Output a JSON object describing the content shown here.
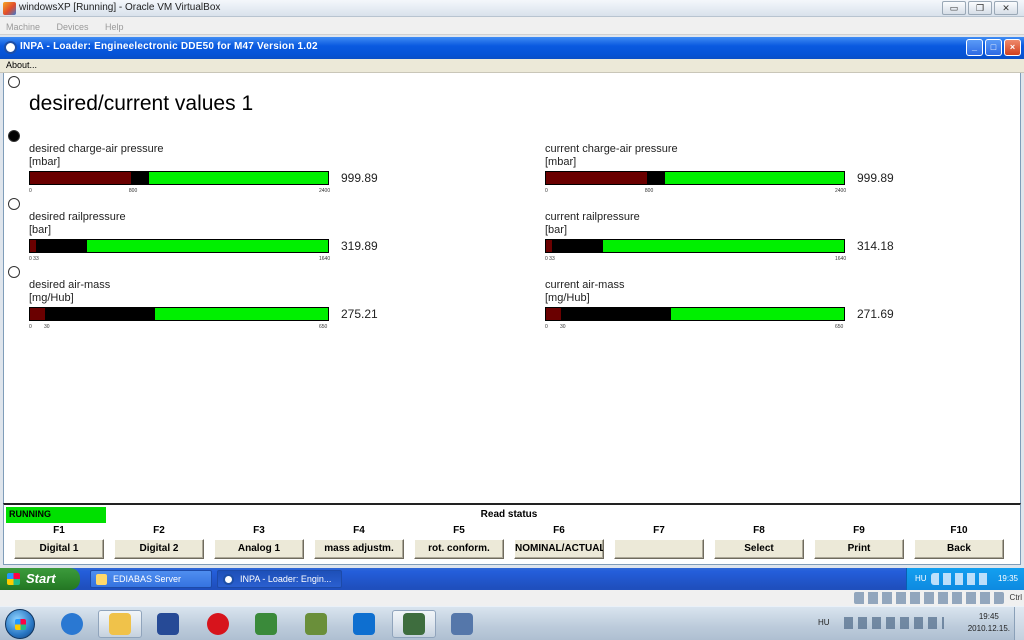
{
  "host_window": {
    "title": "windowsXP [Running] - Oracle VM VirtualBox",
    "menu": [
      "Machine",
      "Devices",
      "Help"
    ],
    "controls": [
      "▭",
      "❐",
      "✕"
    ]
  },
  "app_window": {
    "title": "INPA - Loader:  Engineelectronic DDE50 for M47 Version 1.02",
    "menu": [
      "About..."
    ]
  },
  "page": {
    "title": "desired/current values 1"
  },
  "gauges": [
    {
      "label": "desired charge-air pressure",
      "unit": "[mbar]",
      "value": "999.89",
      "fill": 0.4,
      "red": 0.34,
      "ticks": [
        {
          "t": "0",
          "p": 0
        },
        {
          "t": "800",
          "p": 0.333
        },
        {
          "t": "2400",
          "p": 1
        }
      ]
    },
    {
      "label": "current charge-air pressure",
      "unit": "[mbar]",
      "value": "999.89",
      "fill": 0.4,
      "red": 0.34,
      "ticks": [
        {
          "t": "0",
          "p": 0
        },
        {
          "t": "800",
          "p": 0.333
        },
        {
          "t": "2400",
          "p": 1
        }
      ]
    },
    {
      "label": "desired railpressure",
      "unit": "[bar]",
      "value": "319.89",
      "fill": 0.19,
      "red": 0.02,
      "ticks": [
        {
          "t": "0 33",
          "p": 0
        },
        {
          "t": "1640",
          "p": 1
        }
      ]
    },
    {
      "label": "current railpressure",
      "unit": "[bar]",
      "value": "314.18",
      "fill": 0.19,
      "red": 0.02,
      "ticks": [
        {
          "t": "0 33",
          "p": 0
        },
        {
          "t": "1640",
          "p": 1
        }
      ]
    },
    {
      "label": "desired air-mass",
      "unit": "[mg/Hub]",
      "value": "275.21",
      "fill": 0.42,
      "red": 0.05,
      "ticks": [
        {
          "t": "0",
          "p": 0
        },
        {
          "t": "30",
          "p": 0.05
        },
        {
          "t": "650",
          "p": 1
        }
      ]
    },
    {
      "label": "current air-mass",
      "unit": "[mg/Hub]",
      "value": "271.69",
      "fill": 0.42,
      "red": 0.05,
      "ticks": [
        {
          "t": "0",
          "p": 0
        },
        {
          "t": "30",
          "p": 0.05
        },
        {
          "t": "650",
          "p": 1
        }
      ]
    }
  ],
  "status": {
    "running": "RUNNING",
    "read_status": "Read status"
  },
  "function_keys": [
    {
      "key": "F1",
      "label": "Digital 1"
    },
    {
      "key": "F2",
      "label": "Digital 2"
    },
    {
      "key": "F3",
      "label": "Analog 1"
    },
    {
      "key": "F4",
      "label": "mass adjustm."
    },
    {
      "key": "F5",
      "label": "rot. conform."
    },
    {
      "key": "F6",
      "label": "NOMINAL/ACTUAL"
    },
    {
      "key": "F7",
      "label": ""
    },
    {
      "key": "F8",
      "label": "Select"
    },
    {
      "key": "F9",
      "label": "Print"
    },
    {
      "key": "F10",
      "label": "Back"
    }
  ],
  "guest_taskbar": {
    "start": "Start",
    "tasks": [
      "EDIABAS Server",
      "INPA - Loader:  Engin..."
    ],
    "lang": "HU",
    "clock": "19:35"
  },
  "vbox_status": {
    "host_key": "Ctrl"
  },
  "host_taskbar": {
    "pinned_icons": [
      "internet-explorer-icon",
      "explorer-icon",
      "save-icon",
      "opera-icon",
      "excel-icon",
      "network-icon",
      "teamviewer-icon",
      "remote-icon",
      "virtualbox-icon"
    ],
    "lang": "HU",
    "time": "19:45",
    "date": "2010.12.15."
  },
  "colors": {
    "gauge_green": "#00f000",
    "gauge_red": "#6a0000",
    "running_green": "#00e000"
  }
}
